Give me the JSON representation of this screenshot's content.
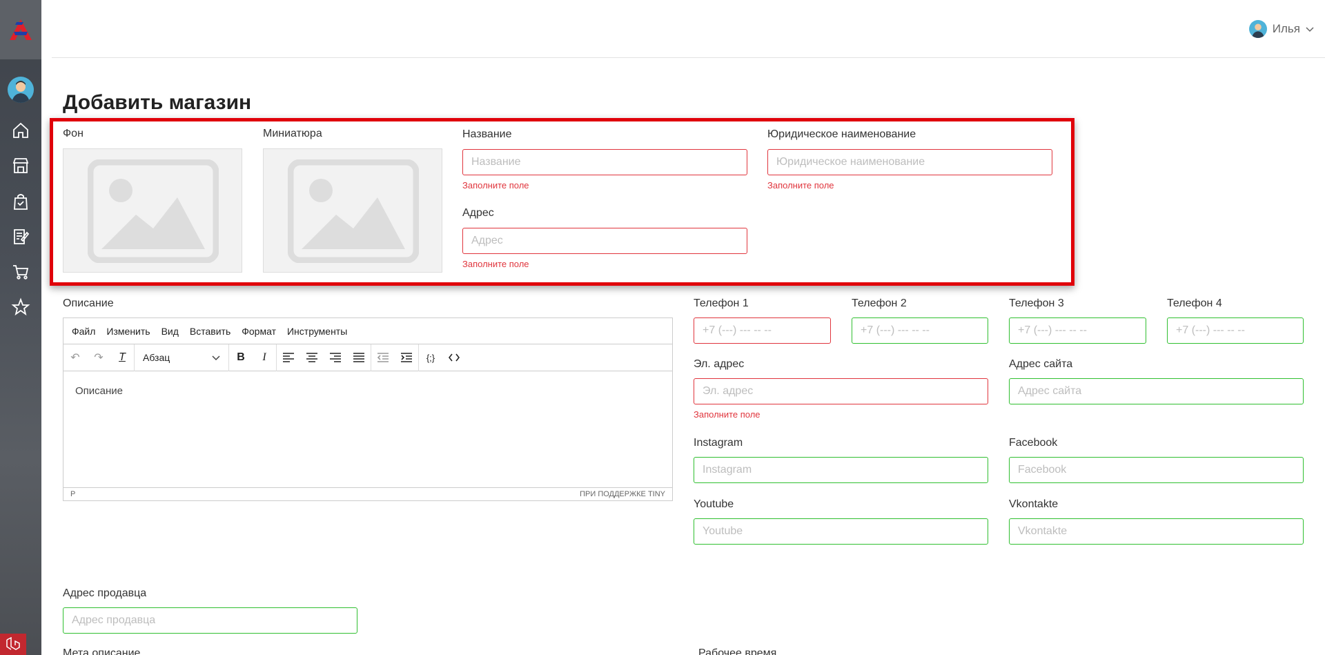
{
  "user": {
    "name": "Илья"
  },
  "page": {
    "title": "Добавить магазин"
  },
  "media": {
    "background_label": "Фон",
    "thumbnail_label": "Миниатюра"
  },
  "fields": {
    "name": {
      "label": "Название",
      "placeholder": "Название",
      "error": "Заполните поле"
    },
    "legal_name": {
      "label": "Юридическое наименование",
      "placeholder": "Юридическое наименование",
      "error": "Заполните поле"
    },
    "address": {
      "label": "Адрес",
      "placeholder": "Адрес",
      "error": "Заполните поле"
    },
    "phone1": {
      "label": "Телефон 1",
      "placeholder": "+7 (---) --- -- --"
    },
    "phone2": {
      "label": "Телефон 2",
      "placeholder": "+7 (---) --- -- --"
    },
    "phone3": {
      "label": "Телефон 3",
      "placeholder": "+7 (---) --- -- --"
    },
    "phone4": {
      "label": "Телефон 4",
      "placeholder": "+7 (---) --- -- --"
    },
    "email": {
      "label": "Эл. адрес",
      "placeholder": "Эл. адрес",
      "error": "Заполните поле"
    },
    "website": {
      "label": "Адрес сайта",
      "placeholder": "Адрес сайта"
    },
    "instagram": {
      "label": "Instagram",
      "placeholder": "Instagram"
    },
    "facebook": {
      "label": "Facebook",
      "placeholder": "Facebook"
    },
    "youtube": {
      "label": "Youtube",
      "placeholder": "Youtube"
    },
    "vkontakte": {
      "label": "Vkontakte",
      "placeholder": "Vkontakte"
    },
    "seller_address": {
      "label": "Адрес продавца",
      "placeholder": "Адрес продавца"
    },
    "meta_description": {
      "label": "Мета описание"
    },
    "working_hours": {
      "label": "Рабочее время"
    }
  },
  "editor": {
    "label": "Описание",
    "menu": [
      "Файл",
      "Изменить",
      "Вид",
      "Вставить",
      "Формат",
      "Инструменты"
    ],
    "block_format": "Абзац",
    "placeholder": "Описание",
    "status_path": "P",
    "branding": "ПРИ ПОДДЕРЖКЕ TINY"
  },
  "colors": {
    "error": "#e0343c",
    "valid": "#2fbf2f",
    "highlight": "#e0000a"
  }
}
